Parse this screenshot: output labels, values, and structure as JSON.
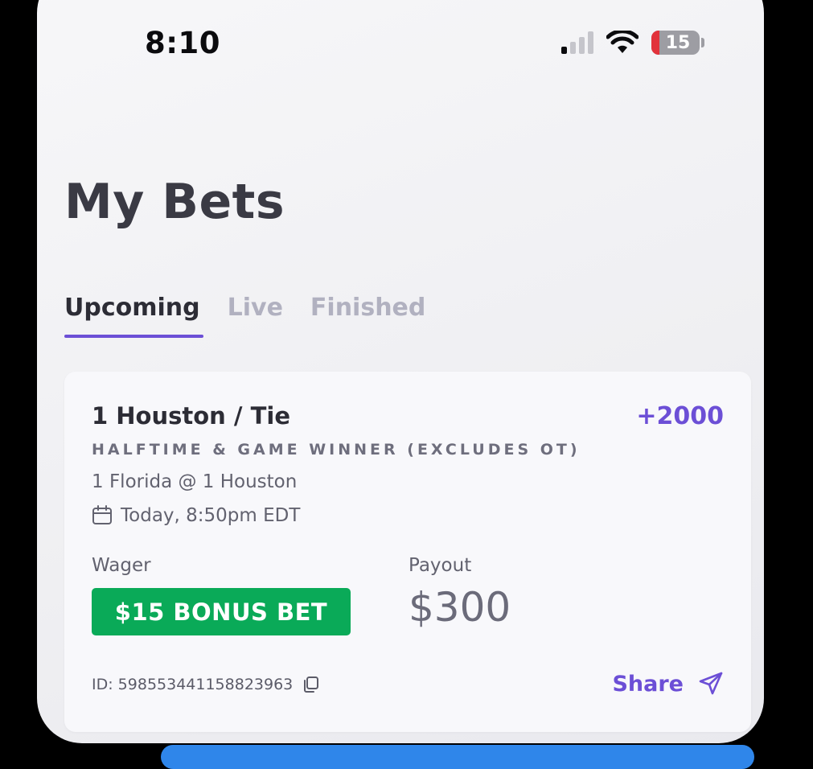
{
  "status_bar": {
    "time": "8:10",
    "battery": "15",
    "icons": [
      "cellular-signal-icon",
      "wifi-icon",
      "battery-icon"
    ]
  },
  "page": {
    "title": "My Bets"
  },
  "tabs": [
    {
      "label": "Upcoming",
      "active": true
    },
    {
      "label": "Live",
      "active": false
    },
    {
      "label": "Finished",
      "active": false
    }
  ],
  "bet": {
    "selection": "1 Houston / Tie",
    "odds": "+2000",
    "market": "HALFTIME & GAME WINNER (EXCLUDES OT)",
    "matchup": "1 Florida @ 1 Houston",
    "start_time": "Today, 8:50pm EDT",
    "wager_label": "Wager",
    "wager_value": "$15 BONUS BET",
    "payout_label": "Payout",
    "payout_value": "$300",
    "id_text": "ID: 598553441158823963",
    "share_label": "Share"
  },
  "colors": {
    "accent": "#6c4fd6",
    "bonus_green": "#0aaa58",
    "battery_low": "#e2323b",
    "bottom_bar": "#2f86ea"
  }
}
